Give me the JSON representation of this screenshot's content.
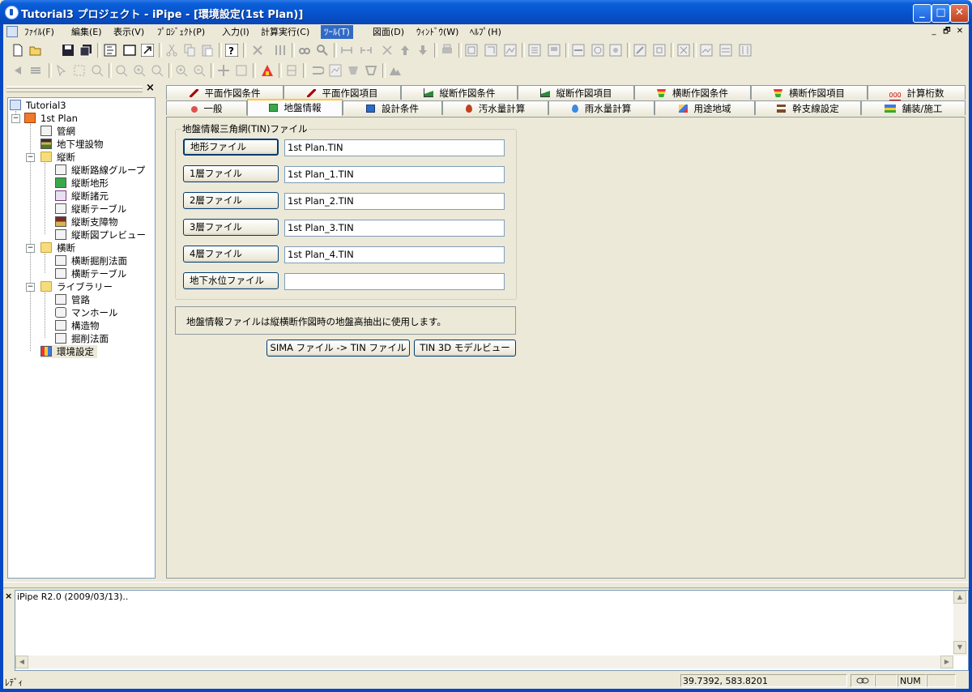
{
  "window": {
    "title": "Tutorial3 プロジェクト - iPipe - [環境設定(1st Plan)]",
    "min_glyph": "_",
    "max_glyph": "□",
    "close_glyph": "✕"
  },
  "menubar": {
    "items": [
      "ﾌｧｲﾙ(F)",
      "編集(E)",
      "表示(V)",
      "ﾌﾟﾛｼﾞｪｸﾄ(P)",
      "入力(I)",
      "計算実行(C)",
      "ﾂｰﾙ(T)",
      "図面(D)",
      "ｳｨﾝﾄﾞｳ(W)",
      "ﾍﾙﾌﾟ(H)"
    ],
    "active": "ﾂｰﾙ(T)",
    "mdi": [
      "_",
      "🗗",
      "✕"
    ]
  },
  "tree": {
    "close_glyph": "×",
    "items": [
      {
        "label": "Tutorial3"
      },
      {
        "label": "1st Plan"
      },
      {
        "label": "管網"
      },
      {
        "label": "地下埋設物"
      },
      {
        "label": "縦断"
      },
      {
        "label": "縦断路線グループ"
      },
      {
        "label": "縦断地形"
      },
      {
        "label": "縦断諸元"
      },
      {
        "label": "縦断テーブル"
      },
      {
        "label": "縦断支障物"
      },
      {
        "label": "縦断図プレビュー"
      },
      {
        "label": "横断"
      },
      {
        "label": "横断掘削法面"
      },
      {
        "label": "横断テーブル"
      },
      {
        "label": "ライブラリー"
      },
      {
        "label": "管路"
      },
      {
        "label": "マンホール"
      },
      {
        "label": "構造物"
      },
      {
        "label": "掘削法面"
      },
      {
        "label": "環境設定"
      }
    ]
  },
  "tabs": {
    "row1": [
      "平面作図条件",
      "平面作図項目",
      "縦断作図条件",
      "縦断作図項目",
      "横断作図条件",
      "横断作図項目",
      "計算桁数"
    ],
    "row2": [
      "一般",
      "地盤情報",
      "設計条件",
      "汚水量計算",
      "雨水量計算",
      "用途地域",
      "幹支線設定",
      "舗装/施工"
    ],
    "selected": "地盤情報"
  },
  "tin_group": {
    "title": "地盤情報三角網(TIN)ファイル",
    "rows": [
      {
        "button": "地形ファイル",
        "value": "1st Plan.TIN"
      },
      {
        "button": "1層ファイル",
        "value": "1st Plan_1.TIN"
      },
      {
        "button": "2層ファイル",
        "value": "1st Plan_2.TIN"
      },
      {
        "button": "3層ファイル",
        "value": "1st Plan_3.TIN"
      },
      {
        "button": "4層ファイル",
        "value": "1st Plan_4.TIN"
      },
      {
        "button": "地下水位ファイル",
        "value": ""
      }
    ]
  },
  "info_text": "地盤情報ファイルは縦横断作図時の地盤高抽出に使用します。",
  "actions": {
    "sima": "SIMA ファイル -> TIN ファイル",
    "tin3d": "TIN 3D モデルビュー"
  },
  "output": {
    "close_glyph": "×",
    "line": "iPipe R2.0 (2009/03/13).."
  },
  "status": {
    "ready": "ﾚﾃﾞｨ",
    "coords": "39.7392, 583.8201",
    "num": "NUM"
  },
  "colors": {
    "titlebar": "#0652cc",
    "menu_active": "#316ac5",
    "tab_highlight": "#ffc83c"
  }
}
